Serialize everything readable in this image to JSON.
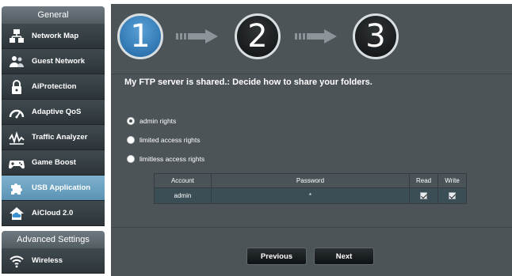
{
  "sidebar": {
    "general_label": "General",
    "items": [
      {
        "label": "Network Map",
        "icon": "network-map-icon"
      },
      {
        "label": "Guest Network",
        "icon": "guest-network-icon"
      },
      {
        "label": "AiProtection",
        "icon": "lock-icon"
      },
      {
        "label": "Adaptive QoS",
        "icon": "gauge-icon"
      },
      {
        "label": "Traffic Analyzer",
        "icon": "traffic-wave-icon"
      },
      {
        "label": "Game Boost",
        "icon": "gamepad-icon"
      },
      {
        "label": "USB Application",
        "icon": "puzzle-icon",
        "active": true
      },
      {
        "label": "AiCloud 2.0",
        "icon": "cloud-house-icon"
      }
    ],
    "advanced_label": "Advanced Settings",
    "advanced_items": [
      {
        "label": "Wireless",
        "icon": "wifi-icon"
      }
    ]
  },
  "wizard": {
    "steps": [
      "1",
      "2",
      "3"
    ],
    "current_step": 1,
    "heading": "My FTP server is shared.: Decide how to share your folders.",
    "options": [
      {
        "label": "admin rights",
        "checked": true
      },
      {
        "label": "limited access rights",
        "checked": false
      },
      {
        "label": "limitless access rights",
        "checked": false
      }
    ],
    "table": {
      "headers": [
        "Account",
        "Password",
        "Read",
        "Write"
      ],
      "rows": [
        {
          "account": "admin",
          "password": "*",
          "read": true,
          "write": true
        }
      ]
    },
    "buttons": {
      "previous": "Previous",
      "next": "Next"
    }
  },
  "colors": {
    "panel_bg": "#4d5458",
    "active_nav": "#6ea3c3",
    "current_step": "#2f7fc0"
  }
}
